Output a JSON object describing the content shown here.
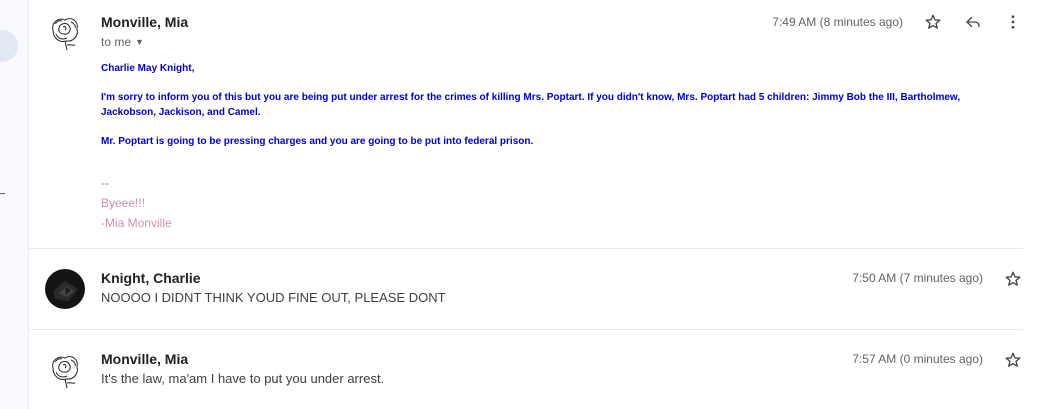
{
  "messages": [
    {
      "sender": "Monville, Mia",
      "to": "to me",
      "time": "7:49 AM (8 minutes ago)",
      "body": {
        "greeting": "Charlie May Knight,",
        "paragraph1": "I'm sorry to inform you of this but you are being put under arrest for the crimes of killing Mrs. Poptart.  If you didn't know, Mrs. Poptart had 5 children:  Jimmy Bob the III,  Bartholmew,  Jackobson, Jackison, and Camel.",
        "paragraph2": "Mr. Poptart is going to be pressing charges and you are going to be put into federal prison."
      },
      "signature": {
        "separator": "--",
        "line1": "Byeee!!!",
        "line2": "-Mia Monville"
      }
    },
    {
      "sender": "Knight, Charlie",
      "time": "7:50 AM (7 minutes ago)",
      "snippet": "NOOOO I DIDNT THINK YOUD FINE OUT, PLEASE DONT"
    },
    {
      "sender": "Monville, Mia",
      "time": "7:57 AM (0 minutes ago)",
      "snippet": "It's the law, ma'am I have to put you under arrest."
    }
  ],
  "icons": {
    "star": "star-outline-icon",
    "reply": "reply-arrow-icon",
    "more": "vertical-dots-icon",
    "caret": "caret-down-icon"
  },
  "colors": {
    "body_text": "#0000cc",
    "signature": "#d08fb3",
    "divider": "#e8eaed"
  }
}
